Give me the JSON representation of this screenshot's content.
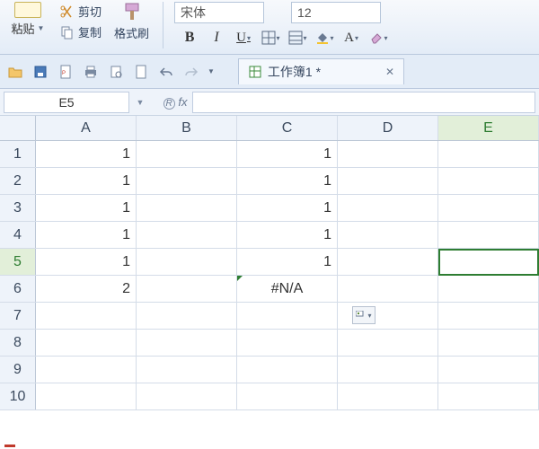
{
  "ribbon": {
    "cut": "剪切",
    "copy": "复制",
    "format_painter": "格式刷",
    "paste": "粘贴",
    "font_name": "宋体",
    "font_size": "12"
  },
  "tab": {
    "title": "工作簿1 *"
  },
  "cell_ref": "E5",
  "fx_label": "fx",
  "columns": [
    "A",
    "B",
    "C",
    "D",
    "E"
  ],
  "rows": [
    "1",
    "2",
    "3",
    "4",
    "5",
    "6",
    "7",
    "8",
    "9",
    "10"
  ],
  "cells": {
    "A1": "1",
    "C1": "1",
    "A2": "1",
    "C2": "1",
    "A3": "1",
    "C3": "1",
    "A4": "1",
    "C4": "1",
    "A5": "1",
    "C5": "1",
    "A6": "2",
    "C6": "#N/A"
  },
  "selected_col": "E",
  "selected_row": "5",
  "smart_tag": "▾"
}
